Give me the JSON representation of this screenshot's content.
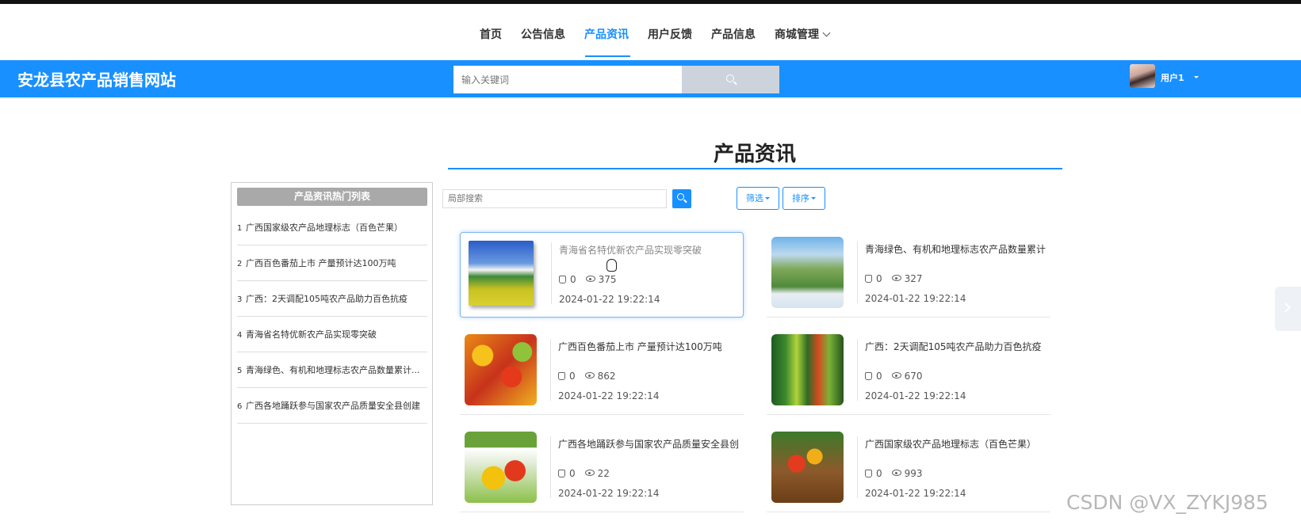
{
  "nav": {
    "items": [
      {
        "label": "首页"
      },
      {
        "label": "公告信息"
      },
      {
        "label": "产品资讯"
      },
      {
        "label": "用户反馈"
      },
      {
        "label": "产品信息"
      },
      {
        "label": "商城管理"
      }
    ],
    "active_index": 2
  },
  "header": {
    "site_title": "安龙县农产品销售网站",
    "search_placeholder": "输入关键词",
    "user_name": "用户1",
    "bg_color": "#1890ff"
  },
  "page": {
    "title": "产品资讯"
  },
  "sidebar": {
    "heading": "产品资讯热门列表",
    "items": [
      {
        "num": "1",
        "label": "广西国家级农产品地理标志（百色芒果）"
      },
      {
        "num": "2",
        "label": "广西百色番茄上市 产量预计达100万吨"
      },
      {
        "num": "3",
        "label": "广西：2天调配105吨农产品助力百色抗疫"
      },
      {
        "num": "4",
        "label": "青海省名特优新农产品实现零突破"
      },
      {
        "num": "5",
        "label": "青海绿色、有机和地理标志农产品数量累计..."
      },
      {
        "num": "6",
        "label": "广西各地踊跃参与国家农产品质量安全县创建"
      }
    ]
  },
  "toolbar": {
    "local_search_placeholder": "局部搜索",
    "filter_label": "筛选",
    "sort_label": "排序"
  },
  "cards": [
    {
      "title": "青海省名特优新农产品实现零突破",
      "likes": "0",
      "views": "375",
      "date": "2024-01-22 19:22:14",
      "image": "landscape"
    },
    {
      "title": "青海绿色、有机和地理标志农产品数量累计",
      "likes": "0",
      "views": "327",
      "date": "2024-01-22 19:22:14",
      "image": "valley"
    },
    {
      "title": "广西百色番茄上市 产量预计达100万吨",
      "likes": "0",
      "views": "862",
      "date": "2024-01-22 19:22:14",
      "image": "fruit"
    },
    {
      "title": "广西：2天调配105吨农产品助力百色抗疫",
      "likes": "0",
      "views": "670",
      "date": "2024-01-22 19:22:14",
      "image": "market"
    },
    {
      "title": "广西各地踊跃参与国家农产品质量安全县创",
      "likes": "0",
      "views": "22",
      "date": "2024-01-22 19:22:14",
      "image": "vegetables"
    },
    {
      "title": "广西国家级农产品地理标志（百色芒果）",
      "likes": "0",
      "views": "993",
      "date": "2024-01-22 19:22:14",
      "image": "basket"
    }
  ],
  "watermark": "CSDN @VX_ZYKJ985",
  "colors": {
    "accent": "#1890ff",
    "sidebar_head": "#a9a9a9"
  }
}
